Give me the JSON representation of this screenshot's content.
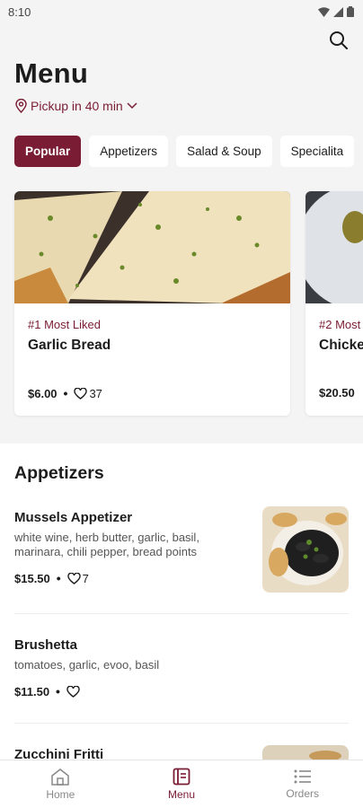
{
  "status": {
    "time": "8:10"
  },
  "header": {
    "title": "Menu",
    "pickup": "Pickup in 40 min"
  },
  "chips": [
    {
      "label": "Popular",
      "active": true
    },
    {
      "label": "Appetizers"
    },
    {
      "label": "Salad & Soup"
    },
    {
      "label": "Specialita"
    }
  ],
  "featured": [
    {
      "rank": "#1 Most Liked",
      "name": "Garlic Bread",
      "price": "$6.00",
      "likes": "37"
    },
    {
      "rank": "#2 Most",
      "name": "Chicke",
      "price": "$20.50"
    }
  ],
  "section": {
    "title": "Appetizers",
    "items": [
      {
        "name": "Mussels Appetizer",
        "desc": "white wine, herb butter, garlic, basil, marinara, chili pepper, bread points",
        "price": "$15.50",
        "likes": "7"
      },
      {
        "name": "Brushetta",
        "desc": "tomatoes, garlic, evoo, basil",
        "price": "$11.50",
        "likes": ""
      },
      {
        "name": "Zucchini Fritti"
      }
    ]
  },
  "nav": [
    {
      "label": "Home",
      "icon": "home-icon"
    },
    {
      "label": "Menu",
      "icon": "menu-book-icon",
      "active": true
    },
    {
      "label": "Orders",
      "icon": "orders-list-icon"
    }
  ],
  "colors": {
    "accent": "#7a1c33",
    "background": "#f4f4f5"
  }
}
